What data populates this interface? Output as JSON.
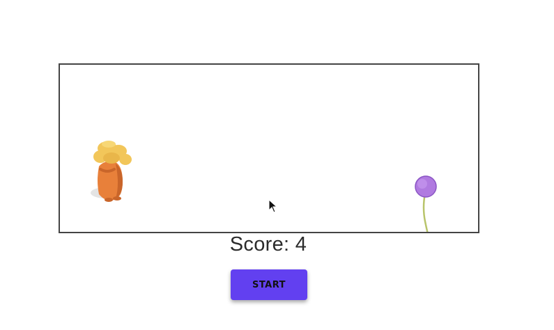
{
  "game": {
    "score_label": "Score:",
    "score_value": "4",
    "start_label": "START"
  },
  "colors": {
    "button_bg": "#6240f0",
    "player_fur": "#e8803a",
    "player_mustache": "#f2c65a",
    "flower_head": "#b07ae0",
    "flower_stem": "#b8c46a",
    "canvas_border": "#444444"
  },
  "icons": {
    "player": "lorax-character",
    "obstacle": "truffula-flower",
    "pointer": "mouse-cursor"
  }
}
